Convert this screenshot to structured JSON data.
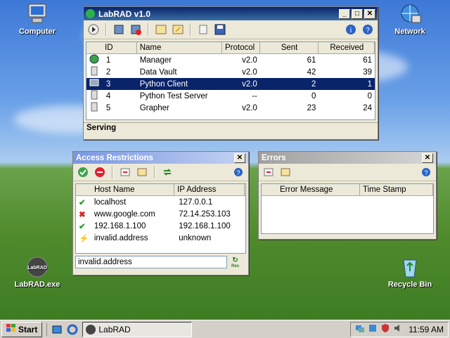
{
  "desktop": {
    "icons": [
      {
        "label": "Computer",
        "icon": "computer-icon"
      },
      {
        "label": "Network",
        "icon": "network-icon"
      },
      {
        "label": "LabRAD.exe",
        "icon": "labrad-icon"
      },
      {
        "label": "Recycle Bin",
        "icon": "recycle-bin-icon"
      }
    ],
    "labrad_icon_text": "LabRAD"
  },
  "main_window": {
    "title": "LabRAD v1.0",
    "controls": {
      "minimize": "_",
      "maximize": "□",
      "close": "✕"
    },
    "columns": [
      "ID",
      "Name",
      "Protocol",
      "Sent",
      "Received"
    ],
    "rows": [
      {
        "id": "1",
        "name": "Manager",
        "protocol": "v2.0",
        "sent": "61",
        "received": "61",
        "icon": "globe-icon"
      },
      {
        "id": "2",
        "name": "Data Vault",
        "protocol": "v2.0",
        "sent": "42",
        "received": "39",
        "icon": "server-icon"
      },
      {
        "id": "3",
        "name": "Python Client",
        "protocol": "v2.0",
        "sent": "2",
        "received": "1",
        "icon": "monitor-icon",
        "selected": true
      },
      {
        "id": "4",
        "name": "Python Test Server",
        "protocol": "--",
        "sent": "0",
        "received": "0",
        "icon": "server-icon"
      },
      {
        "id": "5",
        "name": "Grapher",
        "protocol": "v2.0",
        "sent": "23",
        "received": "24",
        "icon": "server-icon"
      }
    ],
    "status": "Serving"
  },
  "access_window": {
    "title": "Access Restrictions",
    "columns": [
      "Host Name",
      "IP Address"
    ],
    "rows": [
      {
        "host": "localhost",
        "ip": "127.0.0.1",
        "status": "allowed"
      },
      {
        "host": "www.google.com",
        "ip": "72.14.253.103",
        "status": "denied"
      },
      {
        "host": "192.168.1.100",
        "ip": "192.168.1.100",
        "status": "allowed"
      },
      {
        "host": "invalid.address",
        "ip": "unknown",
        "status": "unresolved"
      }
    ],
    "input_value": "invalid.address",
    "resolve_label": "Res"
  },
  "errors_window": {
    "title": "Errors",
    "columns": [
      "Error Message",
      "Time Stamp"
    ]
  },
  "taskbar": {
    "start_label": "Start",
    "task_label": "LabRAD",
    "clock": "11:59 AM"
  },
  "colors": {
    "title_active": "#0a246a",
    "selection": "#0a246a",
    "tool_title": "#7a96df"
  }
}
